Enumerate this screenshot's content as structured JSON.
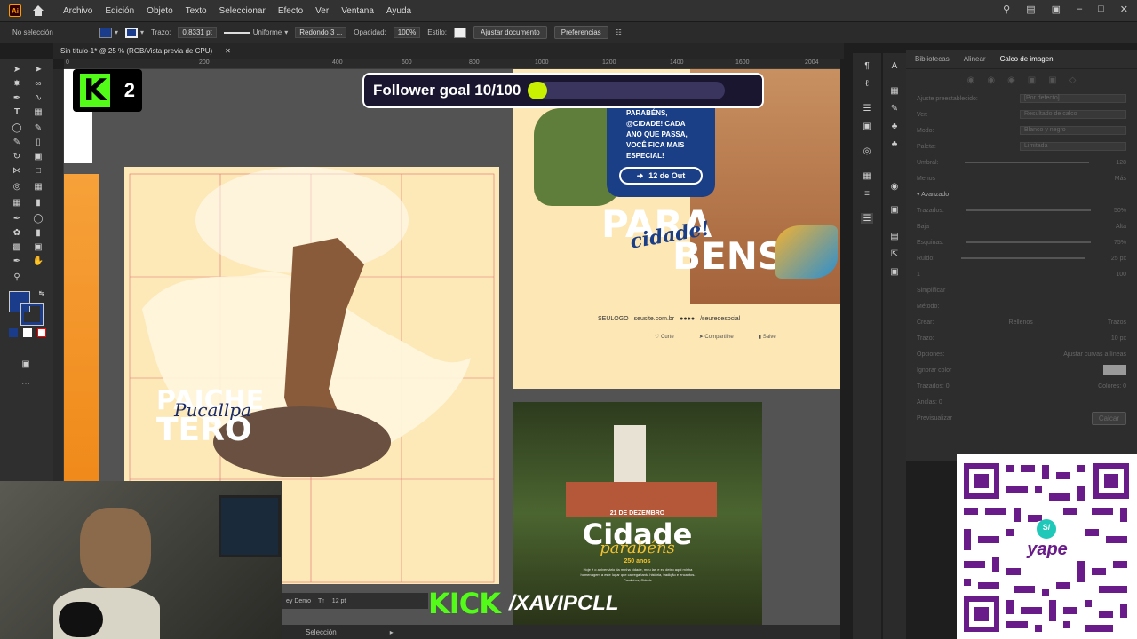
{
  "app": {
    "logo": "Ai",
    "title": "Sin título-1* @ 25 % (RGB/Vista previa de CPU)"
  },
  "menu": [
    "Archivo",
    "Edición",
    "Objeto",
    "Texto",
    "Seleccionar",
    "Efecto",
    "Ver",
    "Ventana",
    "Ayuda"
  ],
  "control_bar": {
    "selection": "No selección",
    "stroke_label": "Trazo:",
    "stroke_value": "0.8331 pt",
    "profile": "Uniforme",
    "brush": "Redondo 3 ...",
    "opacity_label": "Opacidad:",
    "opacity_value": "100%",
    "style_label": "Estilo:",
    "btn_doc": "Ajustar documento",
    "btn_prefs": "Preferencias"
  },
  "ruler": {
    "ticks": [
      "0",
      "200",
      "400",
      "600",
      "800",
      "1000",
      "1200",
      "1400",
      "1600",
      "2004"
    ]
  },
  "panel": {
    "tabs": [
      "Bibliotecas",
      "Alinear",
      "Calco de imagen"
    ],
    "active_tab": "Calco de imagen",
    "rows": [
      {
        "label": "Ajuste preestablecido:",
        "value": "[Por defecto]"
      },
      {
        "label": "Ver:",
        "value": "Resultado de calco"
      },
      {
        "label": "Modo:",
        "value": "Blanco y negro"
      },
      {
        "label": "Paleta:",
        "value": "Limitada"
      },
      {
        "label": "Umbral:",
        "value": "128"
      }
    ],
    "advanced_label": "Avanzado",
    "adv_rows": [
      {
        "label": "Trazados:",
        "value": "50%"
      },
      {
        "label": "Esquinas:",
        "value": "75%"
      },
      {
        "label": "Ruido:",
        "value": "25 px"
      }
    ],
    "method_label": "Método:",
    "create_label": "Crear:",
    "fills": "Rellenos",
    "strokes": "Trazos",
    "stroke_field": "Trazo:",
    "stroke_px": "10 px",
    "options_label": "Opciones:",
    "snap": "Ajustar curvas a líneas",
    "ignore": "Ignorar color",
    "stats": {
      "paths": "Trazados: 0",
      "anchors": "Anclas: 0",
      "colors": "Colores: 0"
    },
    "preview": "Previsualizar",
    "trace_btn": "Calcar",
    "simplify": "Simplificar",
    "min_low": "Menos",
    "min_high": "Más",
    "low": "Baja",
    "high": "Alta",
    "range_lo": "1",
    "range_hi": "100"
  },
  "canvas": {
    "post1": {
      "title1": "PAICHE",
      "title2": "TERO",
      "script": "Pucallpa"
    },
    "post2": {
      "lines": [
        "PARABÉNS,",
        "@CIDADE! CADA",
        "ANO QUE PASSA,",
        "VOCÊ FICA MAIS",
        "ESPECIAL!"
      ],
      "badge": "12 de Out",
      "big1": "PARA",
      "big2": "BENS",
      "script": "cidade!",
      "logo": "SEULOGO",
      "site": "seusite.com.br",
      "handle": "/seuredesocial",
      "actions": [
        "Curte",
        "Compartilhe",
        "Salve"
      ]
    },
    "post3": {
      "date": "21 DE DEZEMBRO",
      "big": "Cidade",
      "script": "parabéns",
      "years": "250 anos",
      "body": "Hoje é o aniversário da minha cidade, meu lar, e eu deixo aqui minha homenagem a este lugar que carrega tanta história, tradição e encantos. Parabéns, Cidade"
    }
  },
  "overlay": {
    "follower": "Follower goal 10/100",
    "follower_progress": 0.1,
    "k2_number": "2",
    "kick_logo": "KICK",
    "kick_name": "/XAVIPCLL",
    "qr_brand": "yape",
    "qr_symbol": "S/"
  },
  "charbar": {
    "font": "ey Demo",
    "size": "12 pt"
  },
  "status": {
    "tool": "Selección"
  }
}
